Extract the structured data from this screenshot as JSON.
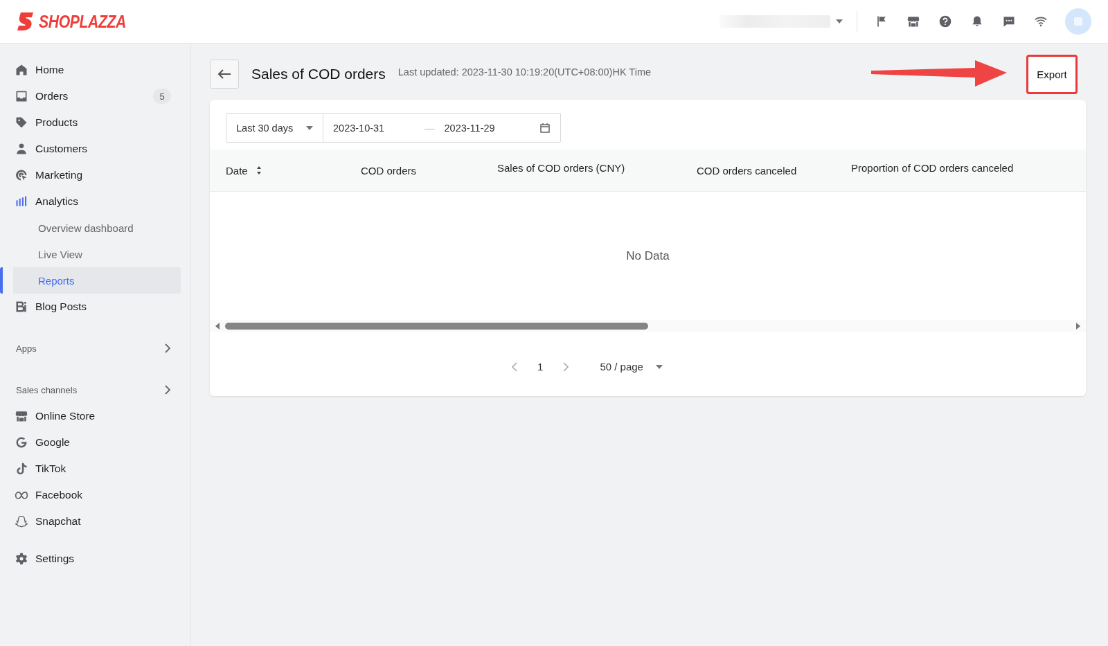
{
  "topbar": {
    "logo": "SHOPLAZZA"
  },
  "sidebar": {
    "items": [
      {
        "label": "Home",
        "selected": false
      },
      {
        "label": "Orders",
        "badge": "5",
        "selected": false
      },
      {
        "label": "Products",
        "selected": false
      },
      {
        "label": "Customers",
        "selected": false
      },
      {
        "label": "Marketing",
        "selected": false
      },
      {
        "label": "Analytics",
        "selected": false,
        "expanded": true,
        "children": [
          {
            "label": "Overview dashboard",
            "selected": false
          },
          {
            "label": "Live View",
            "selected": false
          },
          {
            "label": "Reports",
            "selected": true
          }
        ]
      },
      {
        "label": "Blog Posts",
        "selected": false
      }
    ],
    "sections": [
      {
        "title": "Apps"
      },
      {
        "title": "Sales channels",
        "items": [
          {
            "label": "Online Store",
            "selected": false
          },
          {
            "label": "Google",
            "selected": false
          },
          {
            "label": "TikTok",
            "selected": false
          },
          {
            "label": "Facebook",
            "selected": false
          },
          {
            "label": "Snapchat",
            "selected": false
          }
        ]
      }
    ],
    "settings": {
      "label": "Settings",
      "selected": false
    }
  },
  "page": {
    "title": "Sales of COD orders",
    "last_updated": "Last updated: 2023-11-30 10:19:20(UTC+08:00)HK Time",
    "export_button": "Export"
  },
  "filters": {
    "range": "Last 30 days",
    "start_date": "2023-10-31",
    "separator": "—",
    "end_date": "2023-11-29"
  },
  "table": {
    "columns": [
      "Date",
      "COD orders",
      "Sales of COD orders (CNY)",
      "COD orders canceled",
      "Proportion of COD orders canceled"
    ],
    "empty_text": "No Data"
  },
  "pagination": {
    "page": "1",
    "page_size": "50 / page"
  }
}
